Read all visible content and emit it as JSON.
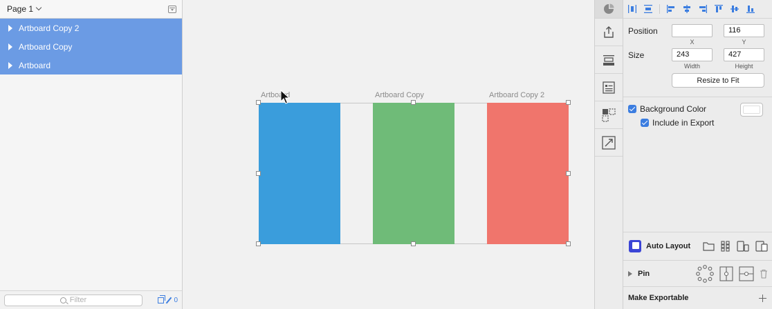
{
  "layers_panel": {
    "page_title": "Page 1",
    "layers": [
      {
        "label": "Artboard Copy 2"
      },
      {
        "label": "Artboard Copy"
      },
      {
        "label": "Artboard"
      }
    ],
    "filter_placeholder": "Filter",
    "footer_count": "0"
  },
  "canvas": {
    "artboards": [
      {
        "label": "Artboard",
        "color": "#3a9ddc"
      },
      {
        "label": "Artboard Copy",
        "color": "#6fbb78"
      },
      {
        "label": "Artboard Copy 2",
        "color": "#f0756c"
      }
    ]
  },
  "inspector": {
    "position_label": "Position",
    "size_label": "Size",
    "x_value": "",
    "y_value": "116",
    "width_value": "243",
    "height_value": "427",
    "x_caption": "X",
    "y_caption": "Y",
    "width_caption": "Width",
    "height_caption": "Height",
    "resize_button": "Resize to Fit",
    "background_color_label": "Background Color",
    "include_export_label": "Include in Export",
    "auto_layout_label": "Auto Layout",
    "pin_label": "Pin",
    "make_exportable_label": "Make Exportable",
    "accent_color": "#3b7de0"
  }
}
